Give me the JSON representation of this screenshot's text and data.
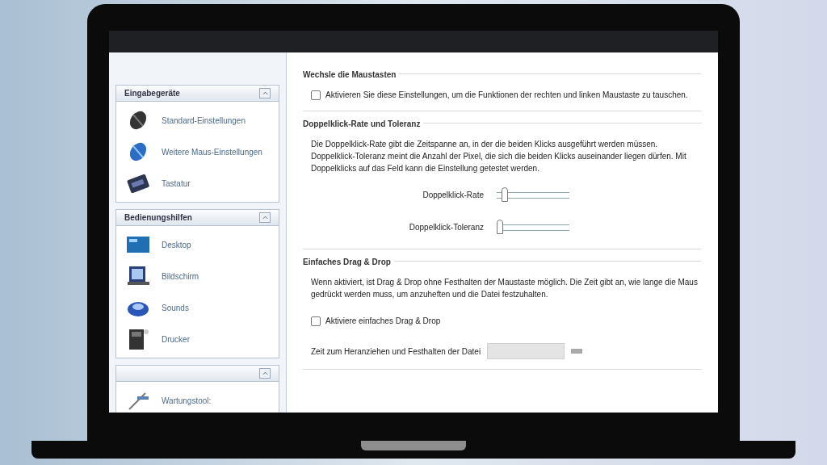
{
  "sidebar": {
    "panels": [
      {
        "title": "Eingabegeräte",
        "items": [
          {
            "label": "Standard-Einstellungen"
          },
          {
            "label": "Weitere Maus-Einstellungen"
          },
          {
            "label": "Tastatur"
          }
        ]
      },
      {
        "title": "Bedienungshilfen",
        "items": [
          {
            "label": "Desktop"
          },
          {
            "label": "Bildschirm"
          },
          {
            "label": "Sounds"
          },
          {
            "label": "Drucker"
          }
        ]
      },
      {
        "items": [
          {
            "label": "Wartungstool:"
          }
        ]
      }
    ]
  },
  "sections": [
    {
      "title": "Wechsle die Maustasten",
      "checkbox": {
        "label": "Aktivieren Sie diese Einstellungen, um die Funktionen der rechten und linken Maustaste zu tauschen.",
        "checked": false
      }
    },
    {
      "title": "Doppelklick-Rate und Toleranz",
      "text": "Die Doppelklick-Rate gibt die Zeitspanne an, in der die beiden Klicks ausgeführt werden müssen. Doppelklick-Toleranz meint die Anzahl der Pixel, die sich die beiden Klicks auseinander liegen dürfen. Mit Doppelklicks auf das Feld kann die Einstellung getestet werden.",
      "sliders": [
        {
          "label": "Doppelklick-Rate",
          "level": 0.07
        },
        {
          "label": "Doppelklick-Toleranz",
          "level": 0.0
        }
      ]
    },
    {
      "title": "Einfaches Drag & Drop",
      "text": "Wenn aktiviert, ist Drag & Drop ohne Festhalten der Maustaste möglich. Die Zeit gibt an, wie lange die Maus gedrückt werden muss, um anzuheften und die Datei festzuhalten.",
      "checkbox": {
        "label": "Aktiviere einfaches Drag & Drop",
        "checked": false
      },
      "field": {
        "label": "Zeit zum Heranziehen und Festhalten der Datei"
      }
    }
  ]
}
